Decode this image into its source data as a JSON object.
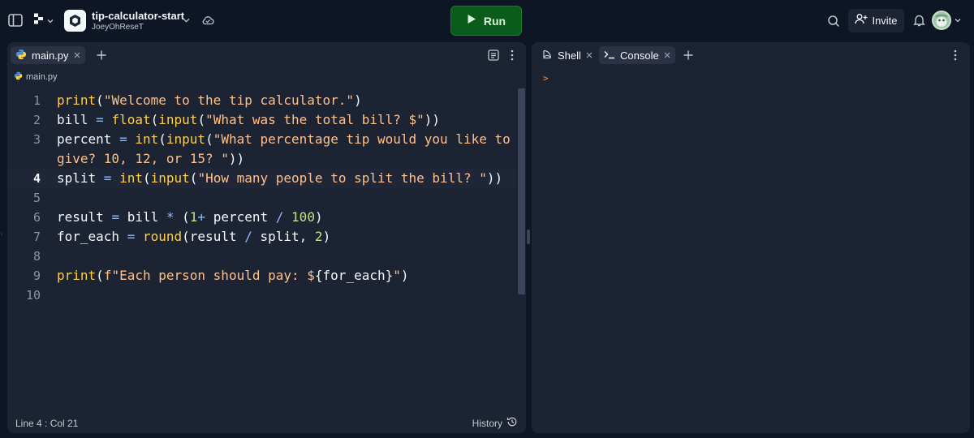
{
  "topbar": {
    "repl_title": "tip-calculator-start",
    "repl_owner": "JoeyOhReseT",
    "run_label": "Run",
    "invite_label": "Invite"
  },
  "editor": {
    "tabs": [
      {
        "label": "main.py",
        "icon": "python-icon",
        "active": true
      }
    ],
    "breadcrumb": "main.py",
    "current_line": 4,
    "lines": [
      {
        "n": "1",
        "tokens": [
          [
            "fn",
            "print"
          ],
          [
            "plain",
            "("
          ],
          [
            "str",
            "\"Welcome to the tip calculator.\""
          ],
          [
            "plain",
            ")"
          ]
        ]
      },
      {
        "n": "2",
        "tokens": [
          [
            "plain",
            "bill "
          ],
          [
            "op",
            "="
          ],
          [
            "plain",
            " "
          ],
          [
            "fn",
            "float"
          ],
          [
            "plain",
            "("
          ],
          [
            "fn",
            "input"
          ],
          [
            "plain",
            "("
          ],
          [
            "str",
            "\"What was the total bill? $\""
          ],
          [
            "plain",
            "))"
          ]
        ]
      },
      {
        "n": "3",
        "tokens": [
          [
            "plain",
            "percent "
          ],
          [
            "op",
            "="
          ],
          [
            "plain",
            " "
          ],
          [
            "fn",
            "int"
          ],
          [
            "plain",
            "("
          ],
          [
            "fn",
            "input"
          ],
          [
            "plain",
            "("
          ],
          [
            "str",
            "\"What percentage tip would you like to"
          ]
        ]
      },
      {
        "n": "",
        "tokens": [
          [
            "str",
            "give? 10, 12, or 15? \""
          ],
          [
            "plain",
            "))"
          ]
        ]
      },
      {
        "n": "4",
        "tokens": [
          [
            "plain",
            "split "
          ],
          [
            "op",
            "="
          ],
          [
            "plain",
            " "
          ],
          [
            "fn",
            "int"
          ],
          [
            "plain",
            "("
          ],
          [
            "fn",
            "input"
          ],
          [
            "plain",
            "("
          ],
          [
            "str",
            "\"How many people to split the bill? \""
          ],
          [
            "plain",
            "))"
          ]
        ]
      },
      {
        "n": "5",
        "tokens": []
      },
      {
        "n": "6",
        "tokens": [
          [
            "plain",
            "result "
          ],
          [
            "op",
            "="
          ],
          [
            "plain",
            " bill "
          ],
          [
            "op",
            "*"
          ],
          [
            "plain",
            " ("
          ],
          [
            "num",
            "1"
          ],
          [
            "op",
            "+"
          ],
          [
            "plain",
            " percent "
          ],
          [
            "op",
            "/"
          ],
          [
            "plain",
            " "
          ],
          [
            "num",
            "100"
          ],
          [
            "plain",
            ")"
          ]
        ]
      },
      {
        "n": "7",
        "tokens": [
          [
            "plain",
            "for_each "
          ],
          [
            "op",
            "="
          ],
          [
            "plain",
            " "
          ],
          [
            "fn",
            "round"
          ],
          [
            "plain",
            "(result "
          ],
          [
            "op",
            "/"
          ],
          [
            "plain",
            " split, "
          ],
          [
            "num",
            "2"
          ],
          [
            "plain",
            ")"
          ]
        ]
      },
      {
        "n": "8",
        "tokens": []
      },
      {
        "n": "9",
        "tokens": [
          [
            "fn",
            "print"
          ],
          [
            "plain",
            "("
          ],
          [
            "str",
            "f\"Each person should pay: $"
          ],
          [
            "plain",
            "{for_each}"
          ],
          [
            "str",
            "\""
          ],
          [
            "plain",
            ")"
          ]
        ]
      },
      {
        "n": "10",
        "tokens": []
      }
    ],
    "status": {
      "cursor": "Line 4 : Col 21",
      "history_label": "History"
    }
  },
  "console": {
    "tabs": [
      {
        "label": "Shell",
        "icon": "shell-icon",
        "active": false
      },
      {
        "label": "Console",
        "icon": "terminal-icon",
        "active": true
      }
    ],
    "prompt": ">"
  },
  "colors": {
    "background": "#0e1525",
    "panel": "#1c2333",
    "run": "#0b5b1a",
    "function": "#ffcf4a",
    "string": "#ffc18a",
    "number": "#bfe38a",
    "operator": "#8fb9ff"
  }
}
